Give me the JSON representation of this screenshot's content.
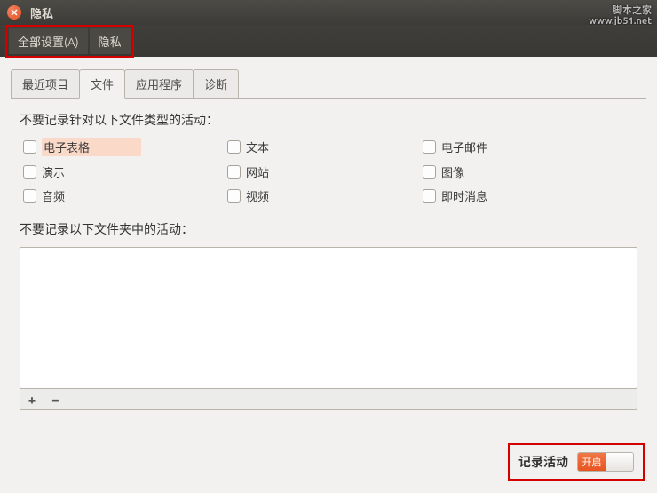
{
  "window": {
    "title": "隐私"
  },
  "breadcrumb": {
    "all_settings": "全部设置(A)",
    "current": "隐私"
  },
  "tabs": {
    "recent": "最近项目",
    "files": "文件",
    "apps": "应用程序",
    "diag": "诊断"
  },
  "filetypes": {
    "heading": "不要记录针对以下文件类型的活动：",
    "items": {
      "spreadsheet": "电子表格",
      "text": "文本",
      "email": "电子邮件",
      "presentation": "演示",
      "website": "网站",
      "image": "图像",
      "audio": "音频",
      "video": "视频",
      "im": "即时消息"
    }
  },
  "folders": {
    "heading": "不要记录以下文件夹中的活动："
  },
  "buttons": {
    "plus": "+",
    "minus": "−"
  },
  "footer": {
    "label": "记录活动",
    "switch_on": "开启"
  },
  "watermark": {
    "line1": "脚本之家",
    "line2": "www.jb51.net"
  }
}
